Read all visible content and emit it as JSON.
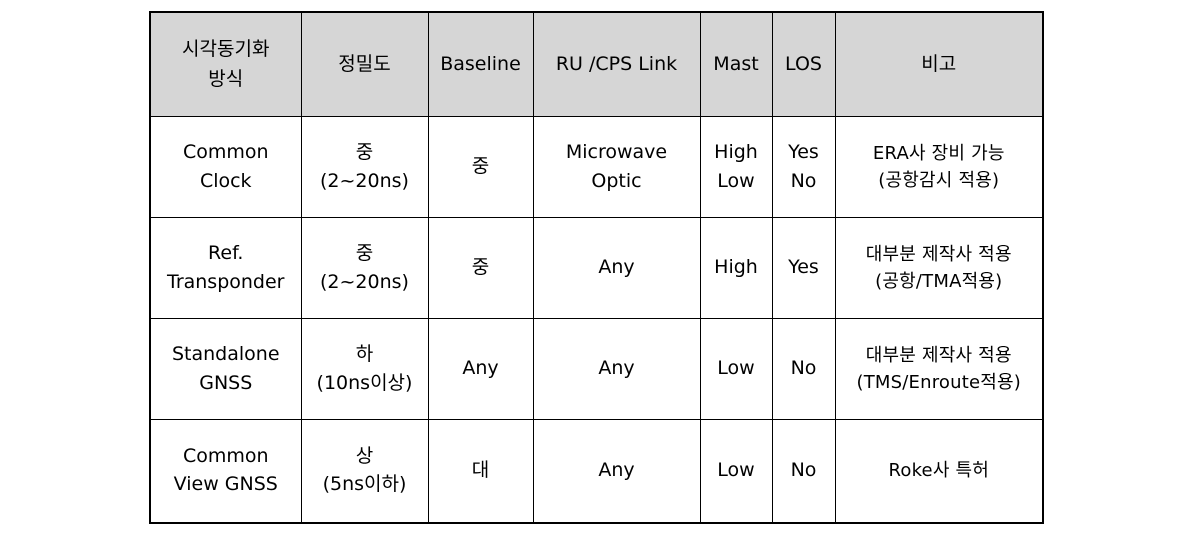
{
  "table": {
    "columns": [
      {
        "key": "method",
        "header_lines": [
          "시각동기화",
          "방식"
        ]
      },
      {
        "key": "accuracy",
        "header_lines": [
          "정밀도"
        ]
      },
      {
        "key": "baseline",
        "header_lines": [
          "Baseline"
        ]
      },
      {
        "key": "link",
        "header_lines": [
          "RU /CPS  Link"
        ]
      },
      {
        "key": "mast",
        "header_lines": [
          "Mast"
        ]
      },
      {
        "key": "los",
        "header_lines": [
          "LOS"
        ]
      },
      {
        "key": "remark",
        "header_lines": [
          "비고"
        ]
      }
    ],
    "rows": [
      {
        "method": [
          "Common",
          "Clock"
        ],
        "accuracy": [
          "중",
          "(2~20ns)"
        ],
        "baseline": [
          "중"
        ],
        "link": [
          "Microwave",
          "Optic"
        ],
        "mast": [
          "High",
          "Low"
        ],
        "los": [
          "Yes",
          "No"
        ],
        "remark": [
          "ERA사 장비 가능",
          "(공항감시 적용)"
        ]
      },
      {
        "method": [
          "Ref.",
          "Transponder"
        ],
        "accuracy": [
          "중",
          "(2~20ns)"
        ],
        "baseline": [
          "중"
        ],
        "link": [
          "Any"
        ],
        "mast": [
          "High"
        ],
        "los": [
          "Yes"
        ],
        "remark": [
          "대부분 제작사 적용",
          "(공항/TMA적용)"
        ]
      },
      {
        "method": [
          "Standalone",
          "GNSS"
        ],
        "accuracy": [
          "하",
          "(10ns이상)"
        ],
        "baseline": [
          "Any"
        ],
        "link": [
          "Any"
        ],
        "mast": [
          "Low"
        ],
        "los": [
          "No"
        ],
        "remark": [
          "대부분 제작사 적용",
          "(TMS/Enroute적용)"
        ]
      },
      {
        "method": [
          "Common",
          "View GNSS"
        ],
        "accuracy": [
          "상",
          "(5ns이하)"
        ],
        "baseline": [
          "대"
        ],
        "link": [
          "Any"
        ],
        "mast": [
          "Low"
        ],
        "los": [
          "No"
        ],
        "remark": [
          "Roke사 특허"
        ]
      }
    ]
  },
  "colors": {
    "header_background": "#d6d6d6",
    "border": "#000000",
    "cell_background": "#ffffff",
    "text": "#000000"
  }
}
